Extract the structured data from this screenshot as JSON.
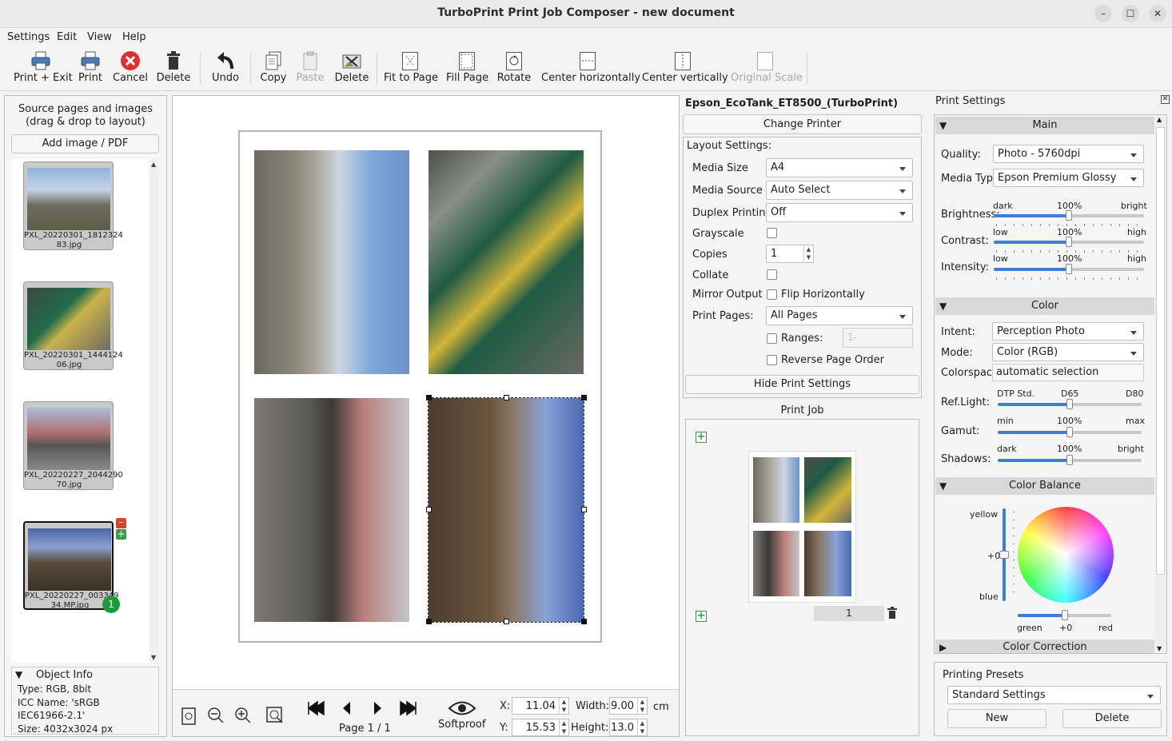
{
  "window": {
    "title": "TurboPrint Print Job Composer - new document",
    "min": "–",
    "max": "☐",
    "close": "✕"
  },
  "menu": [
    "Settings",
    "Edit",
    "View",
    "Help"
  ],
  "toolbar": {
    "print_exit": "Print + Exit",
    "print": "Print",
    "cancel": "Cancel",
    "delete": "Delete",
    "undo": "Undo",
    "copy": "Copy",
    "paste": "Paste",
    "delete2": "Delete",
    "fit": "Fit to Page",
    "fill": "Fill Page",
    "rotate": "Rotate",
    "center_h": "Center horizontally",
    "center_v": "Center vertically",
    "orig": "Original Scale"
  },
  "left": {
    "header1": "Source pages and images",
    "header2": "(drag & drop to layout)",
    "add": "Add image / PDF",
    "thumbs": [
      {
        "l1": "PXL_20220301_1812324",
        "l2": "83.jpg"
      },
      {
        "l1": "PXL_20220301_1444124",
        "l2": "06.jpg"
      },
      {
        "l1": "PXL_20220227_2044290",
        "l2": "70.jpg"
      },
      {
        "l1": "PXL_20220227_003349",
        "l2": "34.MP.jpg"
      }
    ],
    "badge": "1",
    "info": {
      "title": "Object Info",
      "type": "Type: RGB, 8bit",
      "icc": "ICC Name: 'sRGB",
      "icc2": "IEC61966-2.1'",
      "size": "Size: 4032x3024 px"
    }
  },
  "bottom": {
    "page": "Page 1 / 1",
    "softproof": "Softproof",
    "x_label": "X:",
    "x": "11.04",
    "y_label": "Y:",
    "y": "15.53",
    "w_label": "Width:",
    "w": "9.00",
    "h_label": "Height:",
    "h": "13.0",
    "unit": "cm"
  },
  "printer": {
    "name": "Epson_EcoTank_ET8500_(TurboPrint)",
    "change": "Change Printer",
    "layout": "Layout Settings:",
    "media_size_l": "Media Size",
    "media_size": "A4",
    "media_source_l": "Media Source",
    "media_source": "Auto Select",
    "duplex_l": "Duplex Printing",
    "duplex": "Off",
    "gray_l": "Grayscale",
    "copies_l": "Copies",
    "copies": "1",
    "collate_l": "Collate",
    "mirror_l": "Mirror Output",
    "flip": "Flip Horizontally",
    "pages_l": "Print Pages:",
    "pages": "All Pages",
    "ranges": "Ranges:",
    "ranges_ph": "1-",
    "reverse": "Reverse Page Order",
    "hide": "Hide Print Settings",
    "job": "Print Job",
    "job_page": "1"
  },
  "settings": {
    "title": "Print Settings",
    "main": "Main",
    "quality_l": "Quality:",
    "quality": "Photo - 5760dpi",
    "media_l": "Media Type:",
    "media": "Epson Premium Glossy",
    "brightness_l": "Brightness:",
    "contrast_l": "Contrast:",
    "intensity_l": "Intensity:",
    "dark": "dark",
    "bright": "bright",
    "low": "low",
    "high": "high",
    "pct": "100%",
    "color": "Color",
    "intent_l": "Intent:",
    "intent": "Perception Photo",
    "mode_l": "Mode:",
    "mode": "Color (RGB)",
    "cs_l": "Colorspace:",
    "cs": "automatic selection",
    "reflight_l": "Ref.Light:",
    "dtp": "DTP Std.",
    "d65": "D65",
    "d80": "D80",
    "gamut_l": "Gamut:",
    "min": "min",
    "max": "max",
    "shadows_l": "Shadows:",
    "balance": "Color Balance",
    "yellow": "yellow",
    "zero": "+0",
    "blue": "blue",
    "green": "green",
    "red": "red",
    "correction": "Color Correction",
    "presets": "Printing Presets",
    "preset": "Standard Settings",
    "new": "New",
    "delete": "Delete"
  },
  "levels": {
    "brightness": 0.5,
    "contrast": 0.5,
    "intensity": 0.5,
    "reflight": 0.5,
    "gamut": 0.5,
    "shadows": 0.5,
    "balance_v": 0.5,
    "balance_h": 0.5
  }
}
